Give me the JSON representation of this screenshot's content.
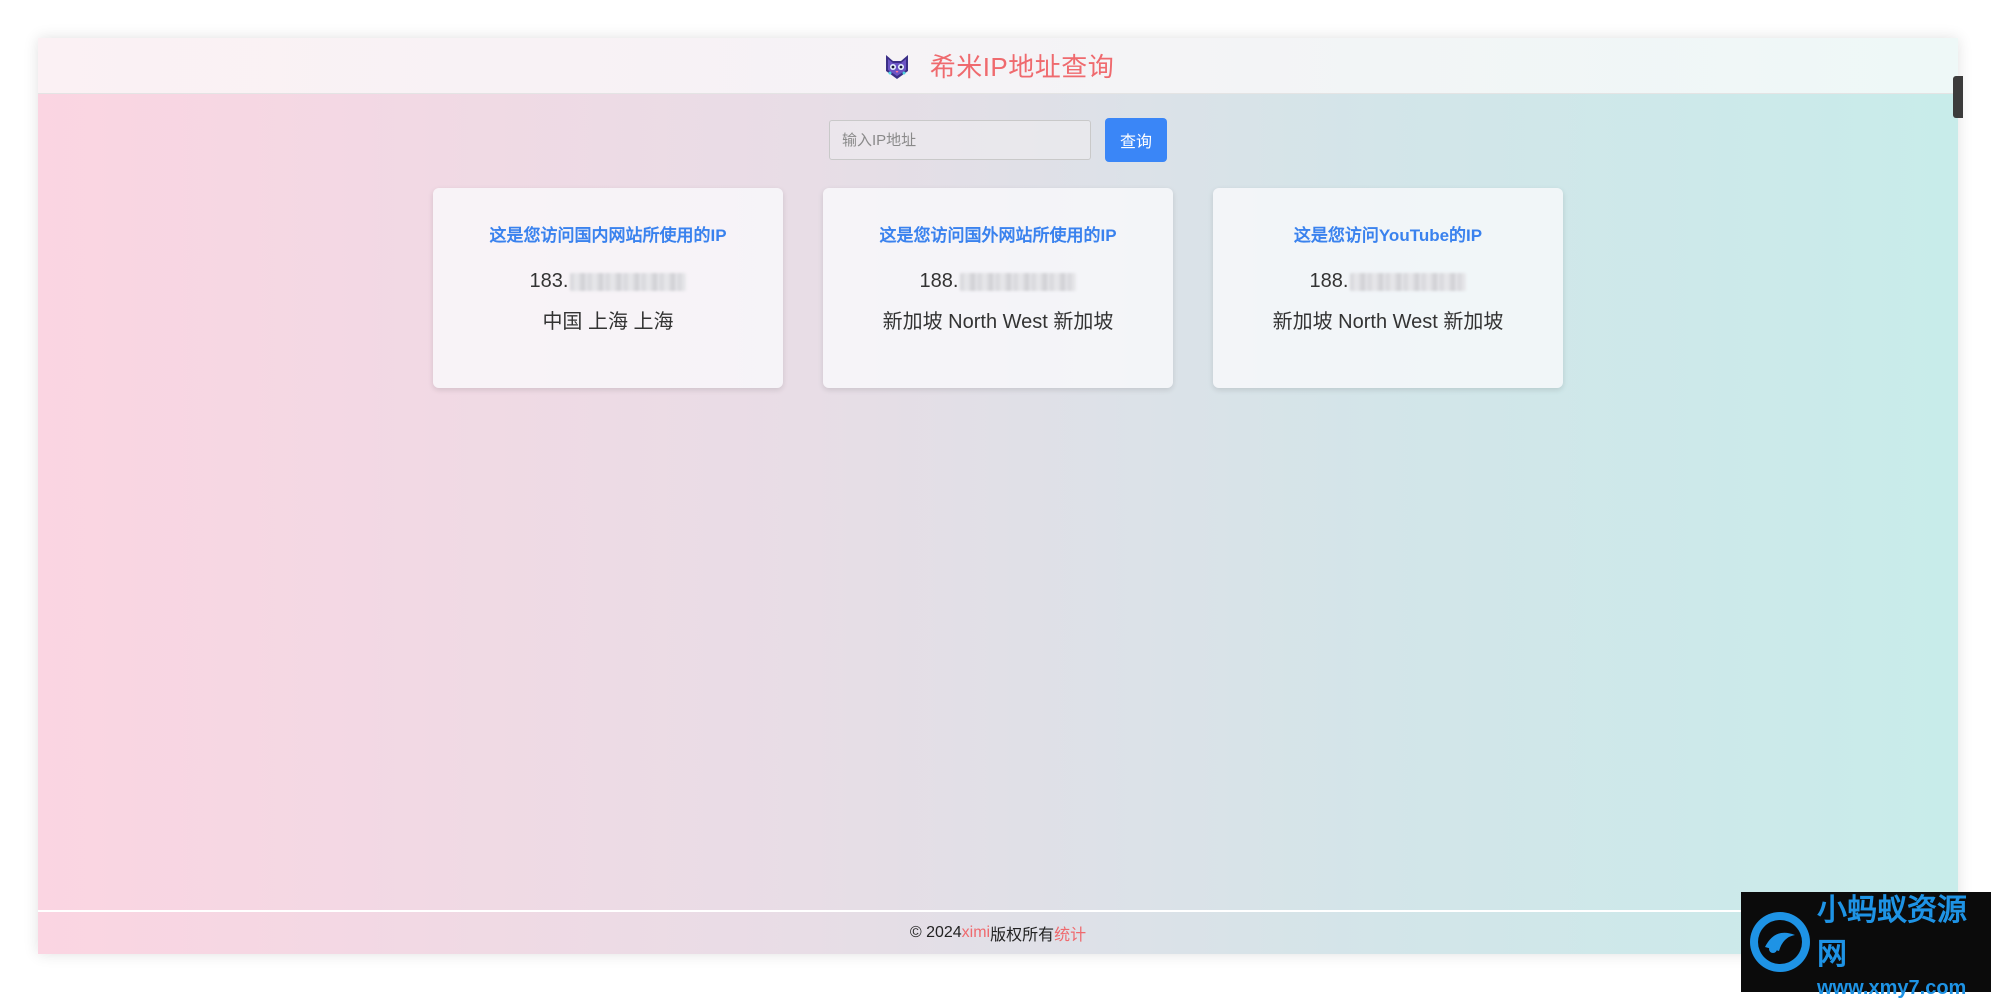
{
  "header": {
    "title": "希米IP地址查询",
    "logo_icon": "cat-logo-icon"
  },
  "search": {
    "placeholder": "输入IP地址",
    "value": "",
    "button_label": "查询"
  },
  "cards": [
    {
      "title": "这是您访问国内网站所使用的IP",
      "ip_prefix": "183.",
      "location": "中国 上海 上海"
    },
    {
      "title": "这是您访问国外网站所使用的IP",
      "ip_prefix": "188.",
      "location": "新加坡 North West 新加坡"
    },
    {
      "title": "这是您访问YouTube的IP",
      "ip_prefix": "188.",
      "location": "新加坡 North West 新加坡"
    }
  ],
  "footer": {
    "copyright": "© 2024 ",
    "author": "ximi",
    "rights": " 版权所有 ",
    "stats_link": "统计"
  },
  "watermark": {
    "cn": "小蚂蚁资源网",
    "en": "www.xmy7.com"
  },
  "colors": {
    "accent": "#ef6a6e",
    "primary": "#3a86f7",
    "card_title": "#3a82ee"
  }
}
